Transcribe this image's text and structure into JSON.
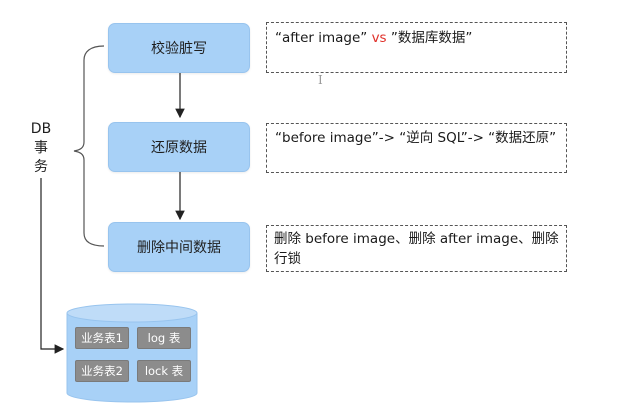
{
  "side_label": [
    "DB",
    "事",
    "务"
  ],
  "steps": [
    {
      "label": "校验脏写"
    },
    {
      "label": "还原数据"
    },
    {
      "label": "删除中间数据"
    }
  ],
  "notes": [
    {
      "before": "“after  image”  ",
      "highlight": "vs",
      "after": " ”数据库数据”"
    },
    {
      "text": "“before image”-> “逆向 SQL”-> “数据还原”"
    },
    {
      "text": "删除 before image、删除 after image、删除行锁"
    }
  ],
  "cursor_glyph": "I",
  "database": {
    "tables": [
      "业务表1",
      "log 表",
      "业务表2",
      "lock 表"
    ]
  },
  "colors": {
    "step_fill": "#a8d1f7",
    "highlight": "#e0302a",
    "table_fill": "#8c8c8c",
    "cylinder_fill": "#a8d1f7"
  }
}
